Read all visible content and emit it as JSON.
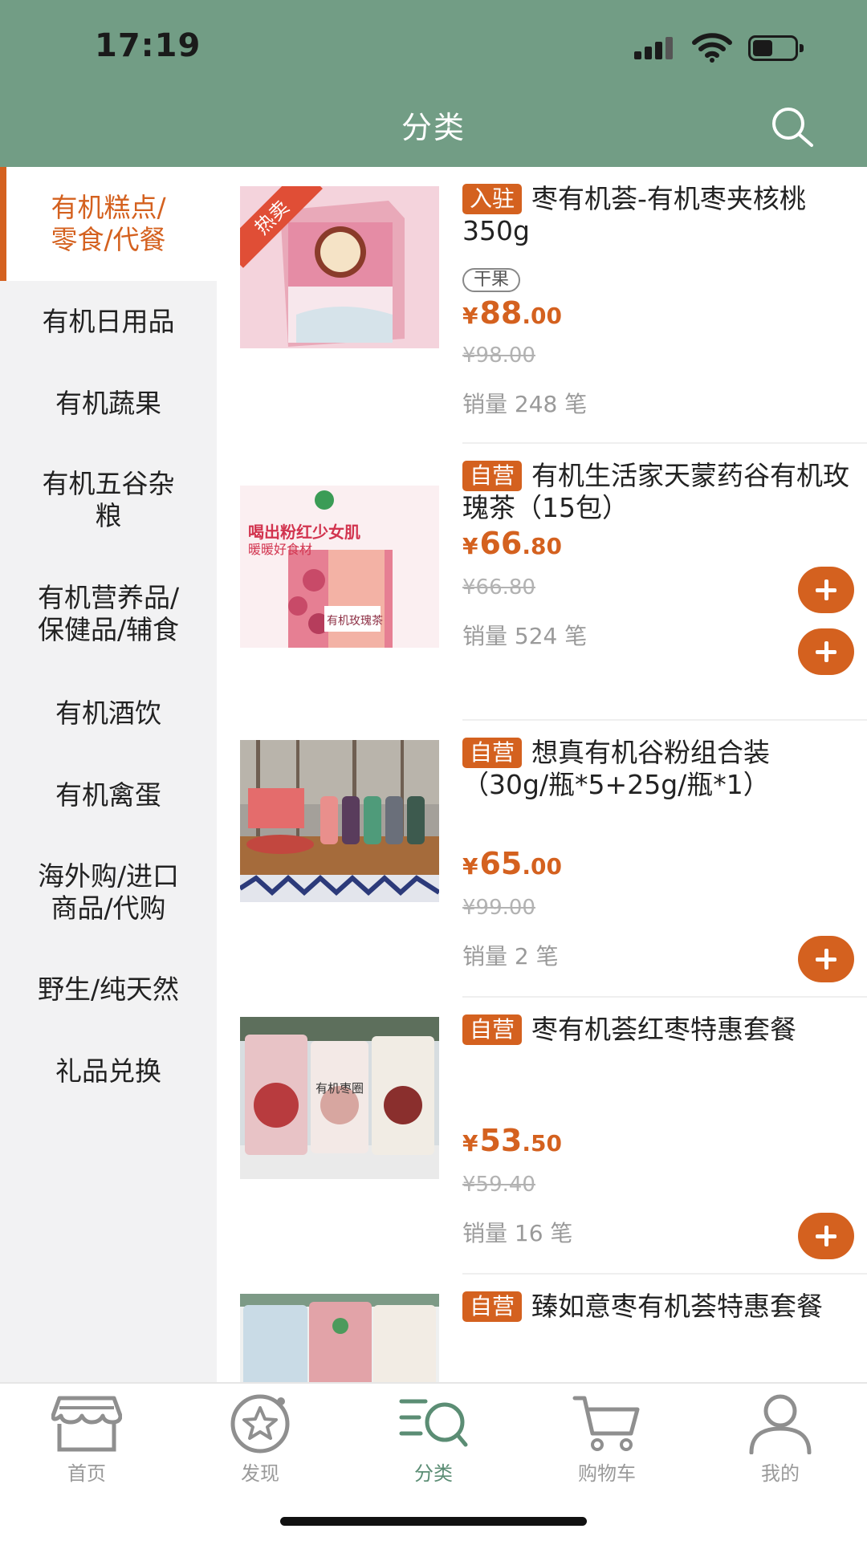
{
  "status": {
    "time": "17:19"
  },
  "header": {
    "title": "分类"
  },
  "sidebar": {
    "items": [
      {
        "label": "有机糕点/\n零食/代餐",
        "active": true
      },
      {
        "label": "有机日用品"
      },
      {
        "label": "有机蔬果"
      },
      {
        "label": "有机五谷杂\n粮"
      },
      {
        "label": "有机营养品/\n保健品/辅食"
      },
      {
        "label": "有机酒饮"
      },
      {
        "label": "有机禽蛋"
      },
      {
        "label": "海外购/进口\n商品/代购"
      },
      {
        "label": "野生/纯天然"
      },
      {
        "label": "礼品兑换"
      }
    ]
  },
  "products": [
    {
      "badge": "入驻",
      "name": "枣有机荟-有机枣夹核桃350g",
      "tag": "干果",
      "hot": "热卖",
      "price_yen": "¥",
      "price_int": "88",
      "price_dec": ".00",
      "old_price": "¥98.00",
      "sales": "销量 248 笔",
      "image": "pink-box-dates-walnuts"
    },
    {
      "badge": "自营",
      "name": "有机生活家天蒙药谷有机玫瑰茶（15包）",
      "price_yen": "¥",
      "price_int": "66",
      "price_dec": ".80",
      "old_price": "¥66.80",
      "sales": "销量 524 笔",
      "image": "rose-tea-box",
      "img_text_1": "喝出粉红少女肌",
      "img_text_2": "暖暖好食材",
      "img_text_3": "有机玫瑰茶"
    },
    {
      "badge": "自营",
      "name": "想真有机谷粉组合装（30g/瓶*5+25g/瓶*1）",
      "price_yen": "¥",
      "price_int": "65",
      "price_dec": ".00",
      "old_price": "¥99.00",
      "sales": "销量 2 笔",
      "image": "grain-powder-bottles"
    },
    {
      "badge": "自营",
      "name": "枣有机荟红枣特惠套餐",
      "price_yen": "¥",
      "price_int": "53",
      "price_dec": ".50",
      "old_price": "¥59.40",
      "sales": "销量 16 笔",
      "image": "red-date-bags",
      "img_text_1": "有机枣圈"
    },
    {
      "badge": "自营",
      "name": "臻如意枣有机荟特惠套餐",
      "image": "date-gift-bags"
    }
  ],
  "tabbar": {
    "items": [
      {
        "label": "首页",
        "icon": "store-icon"
      },
      {
        "label": "发现",
        "icon": "star-circle-icon"
      },
      {
        "label": "分类",
        "icon": "category-search-icon",
        "active": true
      },
      {
        "label": "购物车",
        "icon": "cart-icon"
      },
      {
        "label": "我的",
        "icon": "person-icon"
      }
    ]
  },
  "colors": {
    "header": "#729d85",
    "accent": "#d4611f",
    "active_tab": "#5b8d74"
  }
}
